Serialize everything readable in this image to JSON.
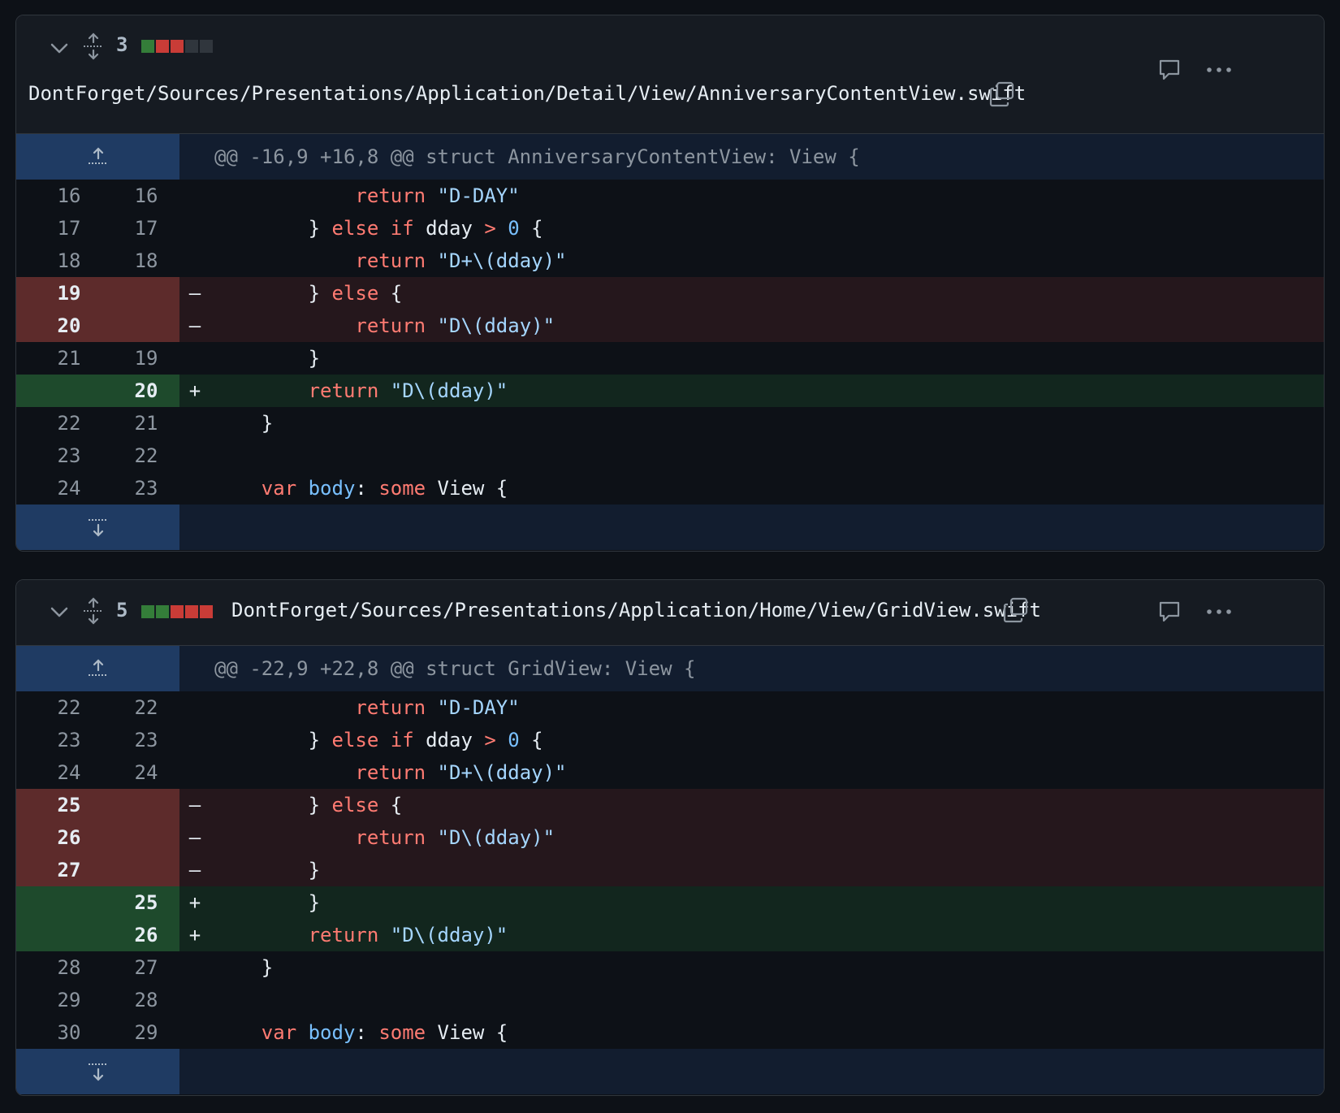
{
  "colors": {
    "added": "#347d39",
    "removed": "#c93c37",
    "neutral": "#30363d"
  },
  "files": [
    {
      "changes": "3",
      "blocks": [
        "added",
        "removed",
        "removed",
        "neutral",
        "neutral"
      ],
      "path": "DontForget/Sources/Presentations/Application/Detail/View/AnniversaryContentView.swift",
      "hunk": "@@ -16,9 +16,8 @@ struct AnniversaryContentView: View {",
      "lines": [
        {
          "type": "ctx",
          "old": "16",
          "new": "16",
          "marker": "",
          "code": [
            {
              "t": "            "
            },
            {
              "t": "return",
              "c": "kw"
            },
            {
              "t": " "
            },
            {
              "t": "\"D-DAY\"",
              "c": "str"
            }
          ]
        },
        {
          "type": "ctx",
          "old": "17",
          "new": "17",
          "marker": "",
          "code": [
            {
              "t": "        } "
            },
            {
              "t": "else",
              "c": "kw"
            },
            {
              "t": " "
            },
            {
              "t": "if",
              "c": "kw"
            },
            {
              "t": " dday "
            },
            {
              "t": ">",
              "c": "kw"
            },
            {
              "t": " "
            },
            {
              "t": "0",
              "c": "num"
            },
            {
              "t": " {"
            }
          ]
        },
        {
          "type": "ctx",
          "old": "18",
          "new": "18",
          "marker": "",
          "code": [
            {
              "t": "            "
            },
            {
              "t": "return",
              "c": "kw"
            },
            {
              "t": " "
            },
            {
              "t": "\"D+\\(dday)\"",
              "c": "str"
            }
          ]
        },
        {
          "type": "del",
          "old": "19",
          "new": "",
          "marker": "–",
          "code": [
            {
              "t": "        } "
            },
            {
              "t": "else",
              "c": "kw"
            },
            {
              "t": " {"
            }
          ]
        },
        {
          "type": "del",
          "old": "20",
          "new": "",
          "marker": "–",
          "code": [
            {
              "t": "            "
            },
            {
              "t": "return",
              "c": "kw"
            },
            {
              "t": " "
            },
            {
              "t": "\"D\\(dday)\"",
              "c": "str"
            }
          ]
        },
        {
          "type": "ctx",
          "old": "21",
          "new": "19",
          "marker": "",
          "code": [
            {
              "t": "        }"
            }
          ]
        },
        {
          "type": "add",
          "old": "",
          "new": "20",
          "marker": "+",
          "code": [
            {
              "t": "        "
            },
            {
              "t": "return",
              "c": "kw"
            },
            {
              "t": " "
            },
            {
              "t": "\"D\\(dday)\"",
              "c": "str"
            }
          ]
        },
        {
          "type": "ctx",
          "old": "22",
          "new": "21",
          "marker": "",
          "code": [
            {
              "t": "    }"
            }
          ]
        },
        {
          "type": "ctx",
          "old": "23",
          "new": "22",
          "marker": "",
          "code": [
            {
              "t": ""
            }
          ]
        },
        {
          "type": "ctx",
          "old": "24",
          "new": "23",
          "marker": "",
          "code": [
            {
              "t": "    "
            },
            {
              "t": "var",
              "c": "kw"
            },
            {
              "t": " "
            },
            {
              "t": "body",
              "c": "prop"
            },
            {
              "t": ": "
            },
            {
              "t": "some",
              "c": "kw"
            },
            {
              "t": " View {"
            }
          ]
        }
      ]
    },
    {
      "changes": "5",
      "blocks": [
        "added",
        "added",
        "removed",
        "removed",
        "removed"
      ],
      "path": "DontForget/Sources/Presentations/Application/Home/View/GridView.swift",
      "hunk": "@@ -22,9 +22,8 @@ struct GridView: View {",
      "lines": [
        {
          "type": "ctx",
          "old": "22",
          "new": "22",
          "marker": "",
          "code": [
            {
              "t": "            "
            },
            {
              "t": "return",
              "c": "kw"
            },
            {
              "t": " "
            },
            {
              "t": "\"D-DAY\"",
              "c": "str"
            }
          ]
        },
        {
          "type": "ctx",
          "old": "23",
          "new": "23",
          "marker": "",
          "code": [
            {
              "t": "        } "
            },
            {
              "t": "else",
              "c": "kw"
            },
            {
              "t": " "
            },
            {
              "t": "if",
              "c": "kw"
            },
            {
              "t": " dday "
            },
            {
              "t": ">",
              "c": "kw"
            },
            {
              "t": " "
            },
            {
              "t": "0",
              "c": "num"
            },
            {
              "t": " {"
            }
          ]
        },
        {
          "type": "ctx",
          "old": "24",
          "new": "24",
          "marker": "",
          "code": [
            {
              "t": "            "
            },
            {
              "t": "return",
              "c": "kw"
            },
            {
              "t": " "
            },
            {
              "t": "\"D+\\(dday)\"",
              "c": "str"
            }
          ]
        },
        {
          "type": "del",
          "old": "25",
          "new": "",
          "marker": "–",
          "code": [
            {
              "t": "        } "
            },
            {
              "t": "else",
              "c": "kw"
            },
            {
              "t": " {"
            }
          ]
        },
        {
          "type": "del",
          "old": "26",
          "new": "",
          "marker": "–",
          "code": [
            {
              "t": "            "
            },
            {
              "t": "return",
              "c": "kw"
            },
            {
              "t": " "
            },
            {
              "t": "\"D\\(dday)\"",
              "c": "str"
            }
          ]
        },
        {
          "type": "del",
          "old": "27",
          "new": "",
          "marker": "–",
          "code": [
            {
              "t": "        }"
            }
          ]
        },
        {
          "type": "add",
          "old": "",
          "new": "25",
          "marker": "+",
          "code": [
            {
              "t": "        }"
            }
          ]
        },
        {
          "type": "add",
          "old": "",
          "new": "26",
          "marker": "+",
          "code": [
            {
              "t": "        "
            },
            {
              "t": "return",
              "c": "kw"
            },
            {
              "t": " "
            },
            {
              "t": "\"D\\(dday)\"",
              "c": "str"
            }
          ]
        },
        {
          "type": "ctx",
          "old": "28",
          "new": "27",
          "marker": "",
          "code": [
            {
              "t": "    }"
            }
          ]
        },
        {
          "type": "ctx",
          "old": "29",
          "new": "28",
          "marker": "",
          "code": [
            {
              "t": ""
            }
          ]
        },
        {
          "type": "ctx",
          "old": "30",
          "new": "29",
          "marker": "",
          "code": [
            {
              "t": "    "
            },
            {
              "t": "var",
              "c": "kw"
            },
            {
              "t": " "
            },
            {
              "t": "body",
              "c": "prop"
            },
            {
              "t": ": "
            },
            {
              "t": "some",
              "c": "kw"
            },
            {
              "t": " View {"
            }
          ]
        }
      ]
    }
  ]
}
